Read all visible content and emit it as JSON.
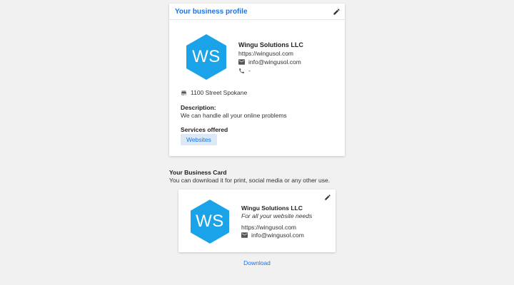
{
  "profile": {
    "header_title": "Your business profile",
    "logo_initials": "WS",
    "name": "Wingu Solutions LLC",
    "url": "https://wingusol.com",
    "email": "info@wingusol.com",
    "phone": "-",
    "address": "1100 Street Spokane",
    "description_label": "Description:",
    "description": "We can handle all your online problems",
    "services_label": "Services offered",
    "services": [
      "Websites"
    ]
  },
  "business_card_section": {
    "title": "Your Business Card",
    "subtitle": "You can download it for print, social media or any other use."
  },
  "business_card": {
    "logo_initials": "WS",
    "name": "Wingu Solutions LLC",
    "tagline": "For all your website needs",
    "url": "https://wingusol.com",
    "email": "info@wingusol.com"
  },
  "download_label": "Download",
  "colors": {
    "accent": "#1a73e8",
    "logo_hex": "#1aa3e8",
    "chip_bg": "#dde8f7",
    "page_bg": "#f1f1f1"
  },
  "icons": {
    "edit": "pencil-icon",
    "email": "email-icon",
    "phone": "phone-icon",
    "address": "store-icon"
  }
}
